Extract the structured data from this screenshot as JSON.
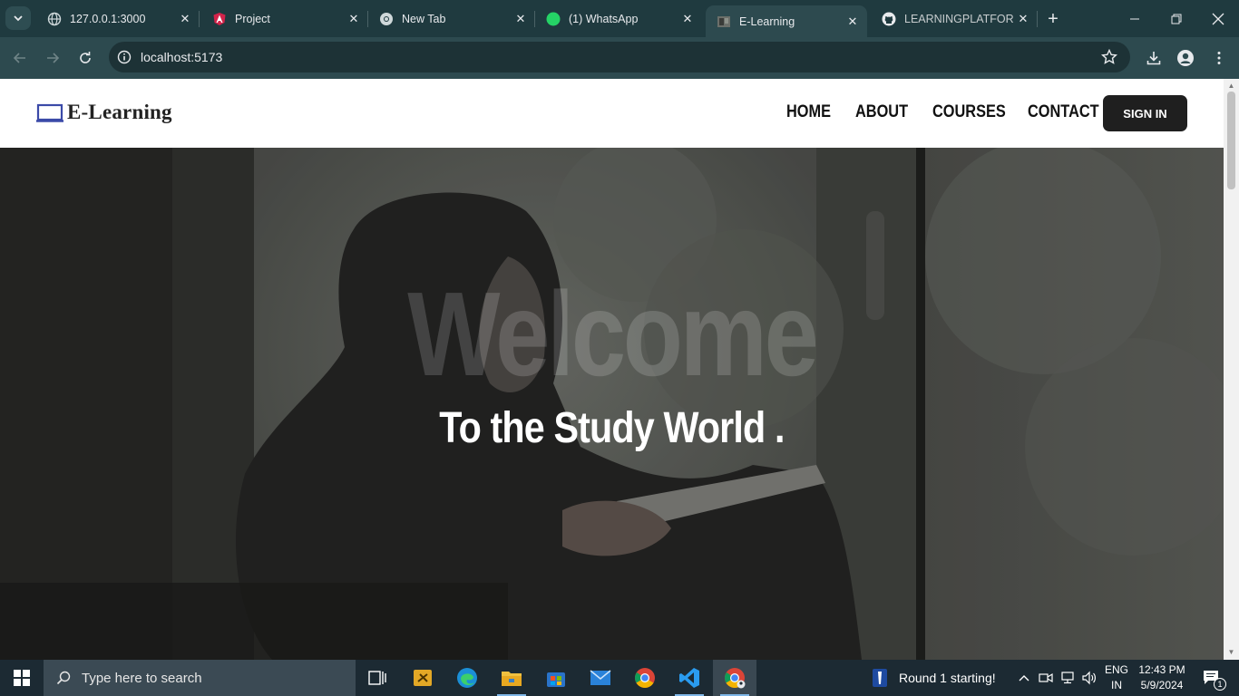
{
  "browser": {
    "tabs": [
      {
        "title": "127.0.0.1:3000",
        "icon": "globe-icon"
      },
      {
        "title": "Project",
        "icon": "angular-icon"
      },
      {
        "title": "New Tab",
        "icon": "chrome-icon"
      },
      {
        "title": "(1) WhatsApp",
        "icon": "whatsapp-icon",
        "badge": "1"
      },
      {
        "title": "E-Learning",
        "icon": "site-thumbnail-icon",
        "active": true
      },
      {
        "title": "LEARNINGPLATFORM",
        "icon": "github-icon"
      }
    ],
    "address": "localhost:5173"
  },
  "site": {
    "brand": "E-Learning",
    "nav": [
      "HOME",
      "ABOUT",
      "COURSES",
      "CONTACT"
    ],
    "signin": "SIGN IN"
  },
  "hero": {
    "title": "Welcome",
    "subtitle": "To the Study World ."
  },
  "taskbar": {
    "search_placeholder": "Type here to search",
    "notification": "Round 1 starting!",
    "lang_top": "ENG",
    "lang_bottom": "IN",
    "time": "12:43 PM",
    "date": "5/9/2024",
    "action_center_count": "1"
  },
  "colors": {
    "tabstrip": "#1f3a3f",
    "toolbar": "#2d4a4f",
    "signin_bg": "#1f1f1f",
    "taskbar": "#1c2a33"
  }
}
